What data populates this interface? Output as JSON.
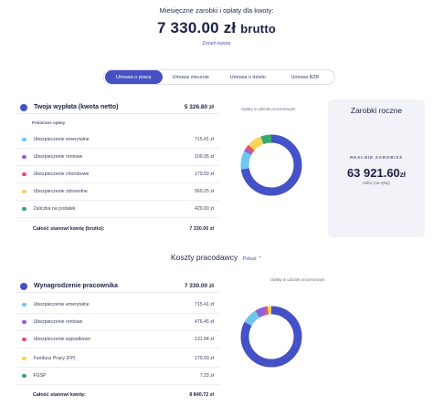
{
  "header": {
    "subtitle": "Miesięczne zarobki i opłaty dla kwoty:",
    "amount": "7 330.00",
    "currency": "zł",
    "mode": "brutto",
    "change_link": "Zmień kwotę"
  },
  "tabs": [
    {
      "label": "Umowa o pracę",
      "active": true
    },
    {
      "label": "Umowa zlecenie",
      "active": false
    },
    {
      "label": "Umowa o dzieło",
      "active": false
    },
    {
      "label": "Umowa B2B",
      "active": false
    }
  ],
  "salary": {
    "net_label": "Twoja wypłata (kwota netto)",
    "net_value": "5 326.80 zł",
    "deductions_header": "Pobierane opłaty",
    "items": [
      {
        "label": "Ubezpieczenie emerytalne",
        "value": "715.41 zł",
        "color": "#6ec6f0"
      },
      {
        "label": "Ubezpieczenie rentowe",
        "value": "109.95 zł",
        "color": "#8b63d6"
      },
      {
        "label": "Ubezpieczenie chorobowe",
        "value": "179.59 zł",
        "color": "#e94f6e"
      },
      {
        "label": "Ubezpieczenie zdrowotne",
        "value": "569.25 zł",
        "color": "#f6d35a"
      },
      {
        "label": "Zaliczka na podatek",
        "value": "429.00 zł",
        "color": "#38a86b"
      }
    ],
    "total_label": "Całość stanowi kwotę (brutto):",
    "total_value": "7 330.00 zł",
    "chart_title": "Opłaty w udziale procentowym",
    "chart_shares": [
      5326.8,
      715.41,
      109.95,
      179.59,
      569.25,
      429.0
    ],
    "chart_colors": [
      "#4551c6",
      "#6ec6f0",
      "#8b63d6",
      "#e94f6e",
      "#f6d35a",
      "#38a86b"
    ]
  },
  "annual": {
    "title": "Zarobki roczne",
    "label": "REALNIE ZAROBISZ",
    "amount": "63 921.60",
    "currency": "zł",
    "note": "netto (na rękę)"
  },
  "costs": {
    "title": "Koszty pracodawcy",
    "show_link": "Pokaż ⌃",
    "gross_label": "Wynagrodzenie pracownika",
    "gross_value": "7 330.00 zł",
    "items": [
      {
        "label": "Ubezpieczenie emerytalne",
        "value": "715.41 zł",
        "color": "#6ec6f0"
      },
      {
        "label": "Ubezpieczenie rentowe",
        "value": "476.45 zł",
        "color": "#8b63d6"
      },
      {
        "label": "Ubezpieczenie wypadkowe",
        "value": "131.94 zł",
        "color": "#e94f6e"
      },
      {
        "label": "Fundusz Pracy (FP)",
        "value": "179.59 zł",
        "color": "#f6d35a"
      },
      {
        "label": "FGŚP",
        "value": "7.33 zł",
        "color": "#38a86b"
      }
    ],
    "total_label": "Całość stanowi kwotę:",
    "total_value": "8 840.72 zł",
    "chart_title": "Opłaty w udziale procentowym",
    "chart_shares": [
      7330.0,
      715.41,
      476.45,
      131.94,
      179.59,
      7.33
    ],
    "chart_colors": [
      "#4551c6",
      "#6ec6f0",
      "#8b63d6",
      "#e94f6e",
      "#f6d35a",
      "#38a86b"
    ]
  }
}
